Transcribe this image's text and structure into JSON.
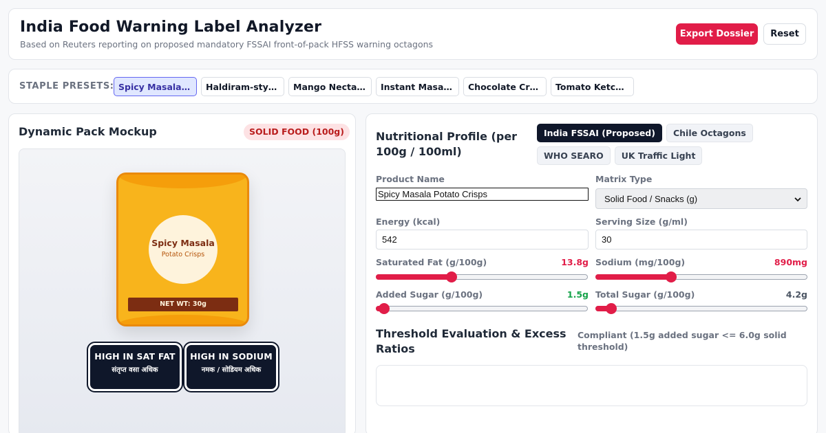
{
  "header": {
    "title": "India Food Warning Label Analyzer",
    "subtitle": "Based on Reuters reporting on proposed mandatory FSSAI front-of-pack HFSS warning octagons",
    "export_label": "Export Dossier",
    "reset_label": "Reset"
  },
  "presets": {
    "label": "STAPLE PRESETS:",
    "items": [
      {
        "label": "Spicy Masala Potato Crisps",
        "active": true
      },
      {
        "label": "Haldiram-style Bhujia",
        "active": false
      },
      {
        "label": "Mango Nectar Drink",
        "active": false
      },
      {
        "label": "Instant Masala Noodles",
        "active": false
      },
      {
        "label": "Chocolate Cream Biscuits",
        "active": false
      },
      {
        "label": "Tomato Ketchup Sauce",
        "active": false
      }
    ]
  },
  "pack_mockup": {
    "title": "Dynamic Pack Mockup",
    "matrix_badge": "SOLID FOOD (100g)",
    "pack_name": "Spicy Masala",
    "pack_subtitle": "Potato Crisps",
    "net_weight": "NET WT: 30g",
    "warnings": [
      {
        "en": "HIGH IN SAT FAT",
        "hi": "संतृप्त वसा अधिक"
      },
      {
        "en": "HIGH IN SODIUM",
        "hi": "नमक / सोडियम अधिक"
      }
    ]
  },
  "profile": {
    "title": "Nutritional Profile (per 100g / 100ml)",
    "standards": [
      {
        "label": "India FSSAI (Proposed)",
        "active": true
      },
      {
        "label": "Chile Octagons",
        "active": false
      },
      {
        "label": "WHO SEARO",
        "active": false
      },
      {
        "label": "UK Traffic Light",
        "active": false
      }
    ],
    "product_name_label": "Product Name",
    "product_name": "Spicy Masala Potato Crisps",
    "matrix_label": "Matrix Type",
    "matrix_value": "Solid Food / Snacks (g)",
    "energy_label": "Energy (kcal)",
    "energy": "542",
    "serving_label": "Serving Size (g/ml)",
    "serving": "30",
    "sliders": [
      {
        "label": "Saturated Fat (g/100g)",
        "display": "13.8g",
        "fraction": 0.356,
        "color": "#e11d48"
      },
      {
        "label": "Sodium (mg/100g)",
        "display": "890mg",
        "fraction": 0.356,
        "color": "#e11d48"
      },
      {
        "label": "Added Sugar (g/100g)",
        "display": "1.5g",
        "fraction": 0.04,
        "color": "#16a34a"
      },
      {
        "label": "Total Sugar (g/100g)",
        "display": "4.2g",
        "fraction": 0.074,
        "color": "#4b5563"
      }
    ]
  },
  "evaluation": {
    "title": "Threshold Evaluation & Excess Ratios",
    "status": "Compliant (1.5g added sugar <= 6.0g solid threshold)"
  }
}
